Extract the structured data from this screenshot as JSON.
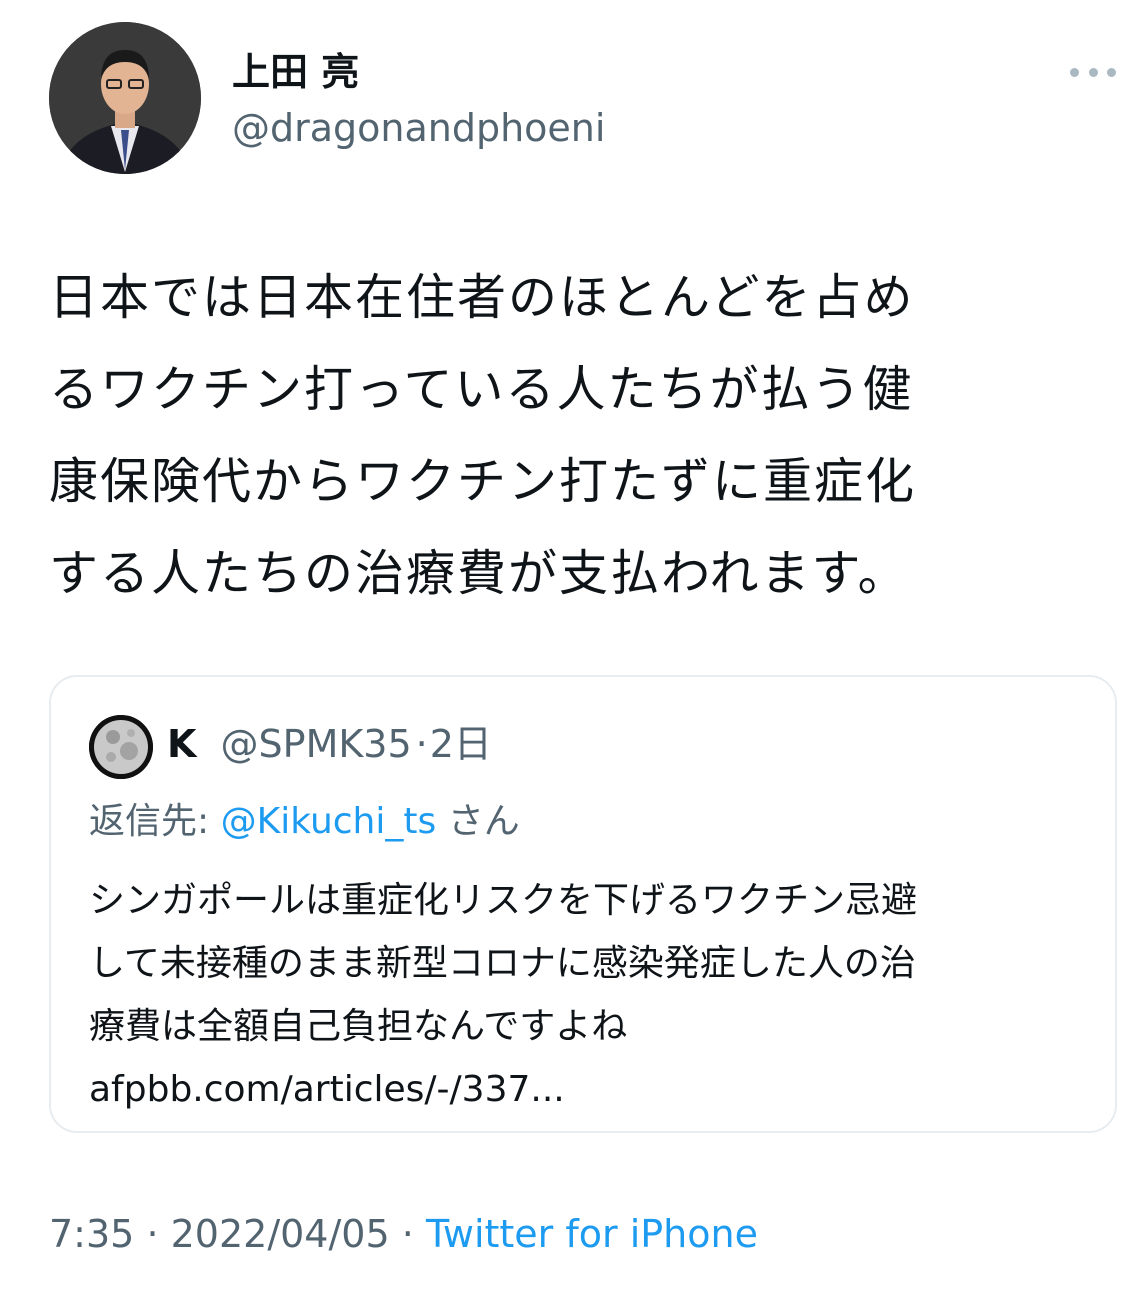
{
  "author": {
    "display_name": "上田 亮",
    "handle": "@dragonandphoeni"
  },
  "more_icon": "more-horizontal-icon",
  "tweet": {
    "text": "日本では日本在住者のほとんどを占め\nるワクチン打っている人たちが払う健\n康保険代からワクチン打たずに重症化\nする人たちの治療費が支払われます。"
  },
  "quoted": {
    "avatar_icon": "moon-icon",
    "name": "K",
    "handle": "@SPMK35",
    "separator": "·",
    "time": "2日",
    "reply_prefix": "返信先:",
    "reply_mention": "@Kikuchi_ts",
    "reply_suffix": "さん",
    "text": "シンガポールは重症化リスクを下げるワクチン忌避\nして未接種のまま新型コロナに感染発症した人の治\n療費は全額自己負担なんですよね\n",
    "link": "afpbb.com/articles/-/337..."
  },
  "footer": {
    "time": "7:35",
    "sep1": "·",
    "date": "2022/04/05",
    "sep2": "·",
    "source": "Twitter for iPhone"
  },
  "colors": {
    "text": "#0f1419",
    "secondary": "#536471",
    "link": "#1d9bf0",
    "border": "#e6ecf0"
  }
}
